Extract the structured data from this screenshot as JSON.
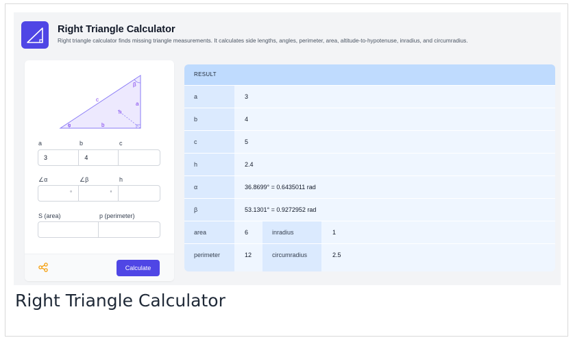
{
  "app": {
    "title": "Right Triangle Calculator",
    "description": "Right triangle calculator finds missing triangle measurements. It calculates side lengths, angles, perimeter, area, altitude-to-hypotenuse, inradius, and circumradius."
  },
  "diagram": {
    "label_beta": "β",
    "label_c": "c",
    "label_a": "a",
    "label_h": "h",
    "label_alpha": "α",
    "label_b": "b"
  },
  "inputs": {
    "sides": {
      "labels": [
        "a",
        "b",
        "c"
      ],
      "values": [
        "3",
        "4",
        ""
      ]
    },
    "angles": {
      "labels": [
        "∠α",
        "∠β",
        "h"
      ],
      "values": [
        "",
        "",
        ""
      ],
      "unit": "°"
    },
    "area_perimeter": {
      "labels": [
        "S (area)",
        "p (perimeter)"
      ],
      "values": [
        "",
        ""
      ]
    }
  },
  "footer": {
    "calculate_label": "Calculate"
  },
  "result": {
    "header": "RESULT",
    "rows": [
      {
        "key": "a",
        "value": "3"
      },
      {
        "key": "b",
        "value": "4"
      },
      {
        "key": "c",
        "value": "5"
      },
      {
        "key": "h",
        "value": "2.4"
      },
      {
        "key": "α",
        "value": "36.8699° = 0.6435011 rad"
      },
      {
        "key": "β",
        "value": "53.1301° = 0.9272952 rad"
      },
      {
        "key": "area",
        "value": "6",
        "key2": "inradius",
        "value2": "1"
      },
      {
        "key": "perimeter",
        "value": "12",
        "key2": "circumradius",
        "value2": "2.5"
      }
    ]
  },
  "caption": "Right Triangle Calculator",
  "icons": {
    "app": "triangle-icon",
    "share": "share-icon"
  },
  "colors": {
    "accent": "#4f46e5",
    "result_header": "#bfdbfe",
    "result_key": "#dbeafe",
    "result_body": "#eff6ff",
    "triangle_stroke": "#8b7cf6",
    "triangle_fill": "#ede9fe",
    "share_icon": "#f59e0b"
  }
}
